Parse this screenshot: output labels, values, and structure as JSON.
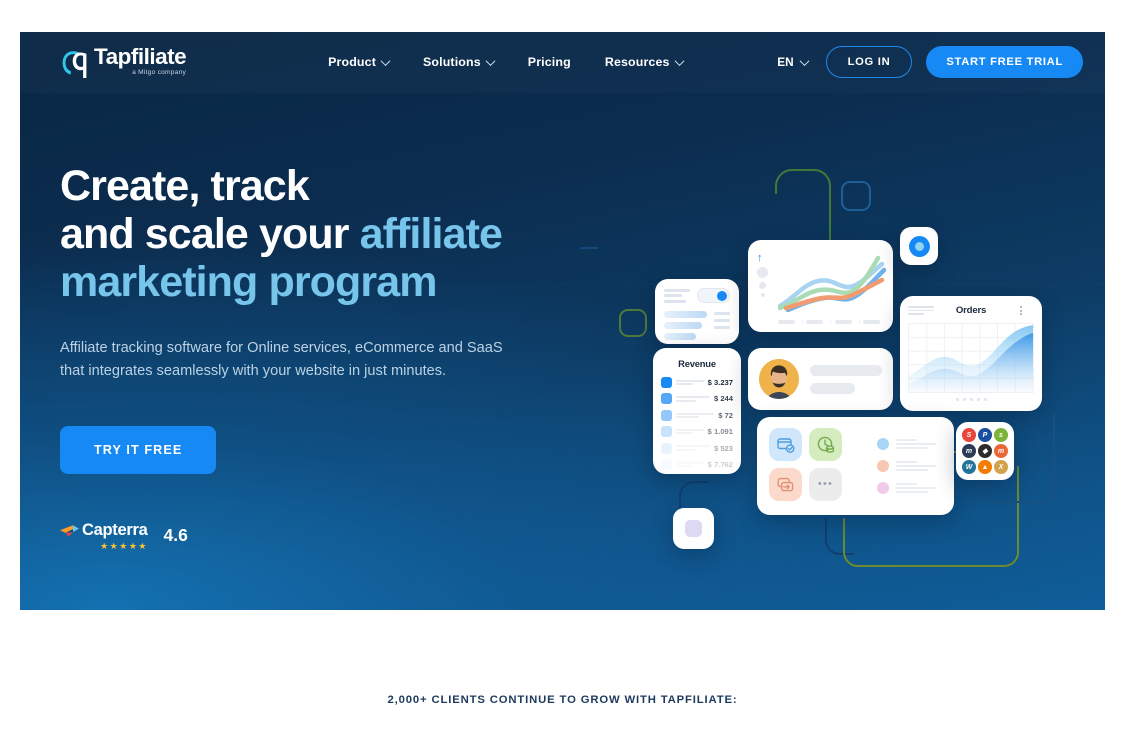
{
  "brand": {
    "name": "Tapfiliate",
    "tagline": "a Mitgo company",
    "accent": "#1789f5",
    "accent_light": "#77c5ea",
    "hero_bg_top": "#0a2745",
    "hero_bg_bottom": "#0f5e9a"
  },
  "nav": {
    "links": [
      {
        "label": "Product",
        "has_caret": true
      },
      {
        "label": "Solutions",
        "has_caret": true
      },
      {
        "label": "Pricing",
        "has_caret": false
      },
      {
        "label": "Resources",
        "has_caret": true
      }
    ],
    "language": "EN",
    "login_label": "LOG IN",
    "trial_label": "START FREE TRIAL"
  },
  "hero": {
    "headline_line1": "Create, track",
    "headline_line2_plain": "and scale your ",
    "headline_line2_accent": "affiliate",
    "headline_line3_accent": "marketing program",
    "subcopy": "Affiliate tracking software for Online services, eCommerce and SaaS that integrates seamlessly with your website in just minutes.",
    "cta_label": "TRY IT FREE",
    "rating": {
      "source": "Capterra",
      "value": "4.6",
      "stars": "★★★★★"
    }
  },
  "illustration": {
    "revenue_card": {
      "title": "Revenue",
      "rows": [
        {
          "value": "$ 3.237",
          "swatch": "#1789f5",
          "opacity": 1
        },
        {
          "value": "$ 244",
          "swatch": "#3f9bf7",
          "opacity": 0.88
        },
        {
          "value": "$ 72",
          "swatch": "#6cb4f9",
          "opacity": 0.72
        },
        {
          "value": "$ 1.091",
          "swatch": "#9acdfb",
          "opacity": 0.55
        },
        {
          "value": "$ 523",
          "swatch": "#c3e0fc",
          "opacity": 0.38
        },
        {
          "value": "$ 7.762",
          "swatch": "#dceefd",
          "opacity": 0.24
        }
      ]
    },
    "orders_card": {
      "title": "Orders",
      "menu_icon": "kebab-menu-icon"
    },
    "line_card": {
      "arrow_icon": "arrow-up-icon"
    },
    "toggle_card": {
      "toggle_state": "on"
    },
    "apps_card": {
      "tiles": [
        {
          "icon": "card-check-icon",
          "bg": "#cfe6fb",
          "stroke": "#4f9ee0"
        },
        {
          "icon": "clock-coins-icon",
          "bg": "#d5edbe",
          "stroke": "#74aa4c"
        },
        {
          "icon": "wallet-transfer-icon",
          "bg": "#fbd9cb",
          "stroke": "#e09172"
        },
        {
          "icon": "more-dots-icon",
          "bg": "#ececec",
          "stroke": "#9aa3ae"
        }
      ],
      "list_dots": [
        "#a8d5f5",
        "#f6c7b2",
        "#f3c9ea"
      ]
    },
    "integrations": [
      {
        "name": "stripe",
        "color": "#e8453c"
      },
      {
        "name": "paypal",
        "color": "#1b4fa0"
      },
      {
        "name": "shopify",
        "color": "#7bb43a"
      },
      {
        "name": "mailchimp",
        "color": "#2b3a55"
      },
      {
        "name": "squarespace",
        "color": "#2b2b2b"
      },
      {
        "name": "magento",
        "color": "#ec6737"
      },
      {
        "name": "wordpress",
        "color": "#21759b"
      },
      {
        "name": "firebase",
        "color": "#f57c00"
      },
      {
        "name": "xero",
        "color": "#d2a24c"
      }
    ],
    "badge": {
      "icon": "target-circle-icon"
    }
  },
  "clients": {
    "headline": "2,000+ CLIENTS CONTINUE TO GROW WITH TAPFILIATE:"
  }
}
